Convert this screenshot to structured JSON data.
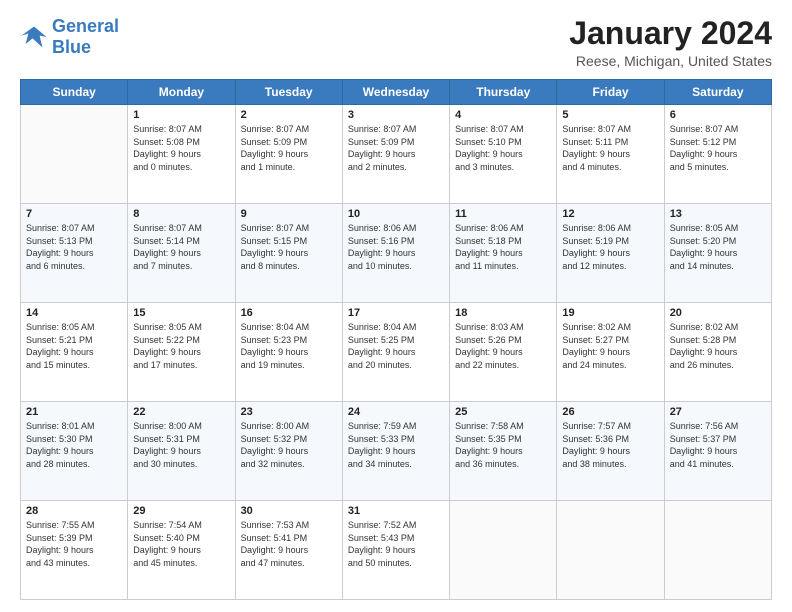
{
  "header": {
    "logo_line1": "General",
    "logo_line2": "Blue",
    "month": "January 2024",
    "location": "Reese, Michigan, United States"
  },
  "weekdays": [
    "Sunday",
    "Monday",
    "Tuesday",
    "Wednesday",
    "Thursday",
    "Friday",
    "Saturday"
  ],
  "weeks": [
    [
      {
        "day": "",
        "info": ""
      },
      {
        "day": "1",
        "info": "Sunrise: 8:07 AM\nSunset: 5:08 PM\nDaylight: 9 hours\nand 0 minutes."
      },
      {
        "day": "2",
        "info": "Sunrise: 8:07 AM\nSunset: 5:09 PM\nDaylight: 9 hours\nand 1 minute."
      },
      {
        "day": "3",
        "info": "Sunrise: 8:07 AM\nSunset: 5:09 PM\nDaylight: 9 hours\nand 2 minutes."
      },
      {
        "day": "4",
        "info": "Sunrise: 8:07 AM\nSunset: 5:10 PM\nDaylight: 9 hours\nand 3 minutes."
      },
      {
        "day": "5",
        "info": "Sunrise: 8:07 AM\nSunset: 5:11 PM\nDaylight: 9 hours\nand 4 minutes."
      },
      {
        "day": "6",
        "info": "Sunrise: 8:07 AM\nSunset: 5:12 PM\nDaylight: 9 hours\nand 5 minutes."
      }
    ],
    [
      {
        "day": "7",
        "info": "Sunrise: 8:07 AM\nSunset: 5:13 PM\nDaylight: 9 hours\nand 6 minutes."
      },
      {
        "day": "8",
        "info": "Sunrise: 8:07 AM\nSunset: 5:14 PM\nDaylight: 9 hours\nand 7 minutes."
      },
      {
        "day": "9",
        "info": "Sunrise: 8:07 AM\nSunset: 5:15 PM\nDaylight: 9 hours\nand 8 minutes."
      },
      {
        "day": "10",
        "info": "Sunrise: 8:06 AM\nSunset: 5:16 PM\nDaylight: 9 hours\nand 10 minutes."
      },
      {
        "day": "11",
        "info": "Sunrise: 8:06 AM\nSunset: 5:18 PM\nDaylight: 9 hours\nand 11 minutes."
      },
      {
        "day": "12",
        "info": "Sunrise: 8:06 AM\nSunset: 5:19 PM\nDaylight: 9 hours\nand 12 minutes."
      },
      {
        "day": "13",
        "info": "Sunrise: 8:05 AM\nSunset: 5:20 PM\nDaylight: 9 hours\nand 14 minutes."
      }
    ],
    [
      {
        "day": "14",
        "info": "Sunrise: 8:05 AM\nSunset: 5:21 PM\nDaylight: 9 hours\nand 15 minutes."
      },
      {
        "day": "15",
        "info": "Sunrise: 8:05 AM\nSunset: 5:22 PM\nDaylight: 9 hours\nand 17 minutes."
      },
      {
        "day": "16",
        "info": "Sunrise: 8:04 AM\nSunset: 5:23 PM\nDaylight: 9 hours\nand 19 minutes."
      },
      {
        "day": "17",
        "info": "Sunrise: 8:04 AM\nSunset: 5:25 PM\nDaylight: 9 hours\nand 20 minutes."
      },
      {
        "day": "18",
        "info": "Sunrise: 8:03 AM\nSunset: 5:26 PM\nDaylight: 9 hours\nand 22 minutes."
      },
      {
        "day": "19",
        "info": "Sunrise: 8:02 AM\nSunset: 5:27 PM\nDaylight: 9 hours\nand 24 minutes."
      },
      {
        "day": "20",
        "info": "Sunrise: 8:02 AM\nSunset: 5:28 PM\nDaylight: 9 hours\nand 26 minutes."
      }
    ],
    [
      {
        "day": "21",
        "info": "Sunrise: 8:01 AM\nSunset: 5:30 PM\nDaylight: 9 hours\nand 28 minutes."
      },
      {
        "day": "22",
        "info": "Sunrise: 8:00 AM\nSunset: 5:31 PM\nDaylight: 9 hours\nand 30 minutes."
      },
      {
        "day": "23",
        "info": "Sunrise: 8:00 AM\nSunset: 5:32 PM\nDaylight: 9 hours\nand 32 minutes."
      },
      {
        "day": "24",
        "info": "Sunrise: 7:59 AM\nSunset: 5:33 PM\nDaylight: 9 hours\nand 34 minutes."
      },
      {
        "day": "25",
        "info": "Sunrise: 7:58 AM\nSunset: 5:35 PM\nDaylight: 9 hours\nand 36 minutes."
      },
      {
        "day": "26",
        "info": "Sunrise: 7:57 AM\nSunset: 5:36 PM\nDaylight: 9 hours\nand 38 minutes."
      },
      {
        "day": "27",
        "info": "Sunrise: 7:56 AM\nSunset: 5:37 PM\nDaylight: 9 hours\nand 41 minutes."
      }
    ],
    [
      {
        "day": "28",
        "info": "Sunrise: 7:55 AM\nSunset: 5:39 PM\nDaylight: 9 hours\nand 43 minutes."
      },
      {
        "day": "29",
        "info": "Sunrise: 7:54 AM\nSunset: 5:40 PM\nDaylight: 9 hours\nand 45 minutes."
      },
      {
        "day": "30",
        "info": "Sunrise: 7:53 AM\nSunset: 5:41 PM\nDaylight: 9 hours\nand 47 minutes."
      },
      {
        "day": "31",
        "info": "Sunrise: 7:52 AM\nSunset: 5:43 PM\nDaylight: 9 hours\nand 50 minutes."
      },
      {
        "day": "",
        "info": ""
      },
      {
        "day": "",
        "info": ""
      },
      {
        "day": "",
        "info": ""
      }
    ]
  ]
}
